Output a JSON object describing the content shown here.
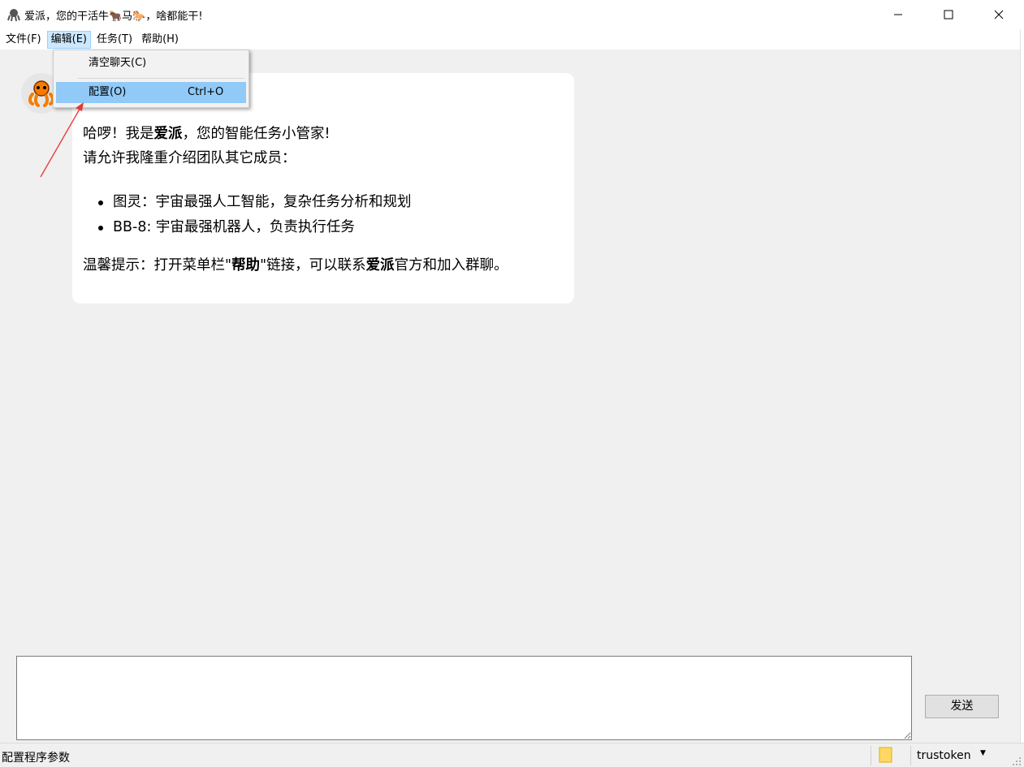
{
  "window": {
    "title": "爱派，您的干活牛🐂马🐎，啥都能干!",
    "controls": {
      "minimize": "—",
      "maximize": "☐",
      "close": "✕"
    }
  },
  "menubar": {
    "items": [
      {
        "label": "文件(F)"
      },
      {
        "label": "编辑(E)"
      },
      {
        "label": "任务(T)"
      },
      {
        "label": "帮助(H)"
      }
    ]
  },
  "edit_menu": {
    "clear_label": "清空聊天(C)",
    "config_label": "配置(O)",
    "config_shortcut": "Ctrl+O"
  },
  "chat": {
    "greeting_pre": "哈啰！我是",
    "greeting_bold": "爱派",
    "greeting_post": "，您的智能任务小管家!",
    "intro": "请允许我隆重介绍团队其它成员：",
    "members": [
      "图灵：宇宙最强人工智能，复杂任务分析和规划",
      "BB-8: 宇宙最强机器人，负责执行任务"
    ],
    "tip_pre": "温馨提示：打开菜单栏\"",
    "tip_bold1": "帮助",
    "tip_mid": "\"链接，可以联系",
    "tip_bold2": "爱派",
    "tip_post": "官方和加入群聊。"
  },
  "input": {
    "value": ""
  },
  "send_button": {
    "label": "发送"
  },
  "statusbar": {
    "text": "配置程序参数",
    "user": "trustoken",
    "caret": "▼"
  },
  "colors": {
    "menu_highlight": "#91c9f7",
    "annotation_arrow": "#e53935",
    "avatar_orange": "#f57c00"
  }
}
